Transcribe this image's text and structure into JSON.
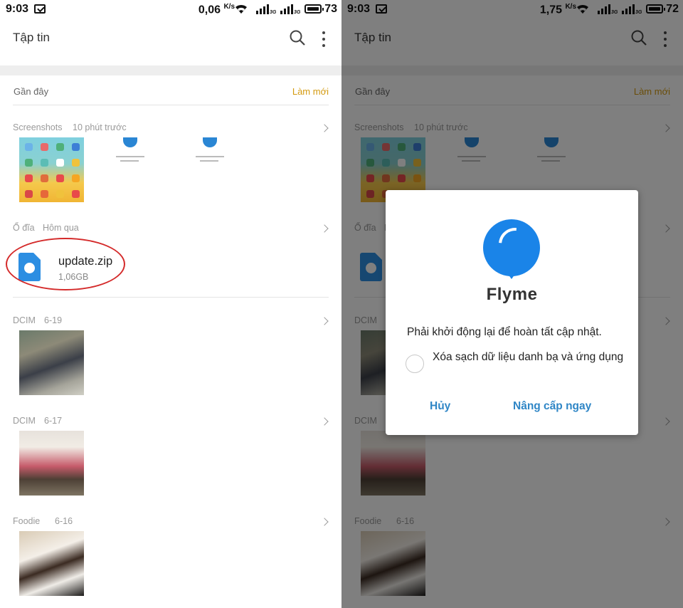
{
  "left": {
    "status": {
      "time": "9:03",
      "speed": "0,06",
      "speed_unit": "K/s",
      "net1": "3G",
      "net2": "3G",
      "battery": "73"
    }
  },
  "right": {
    "status": {
      "time": "9:03",
      "speed": "1,75",
      "speed_unit": "K/s",
      "net1": "3G",
      "net2": "3G",
      "battery": "72"
    }
  },
  "appbar": {
    "title": "Tập tin"
  },
  "recent": {
    "label": "Gần đây",
    "refresh": "Làm mới"
  },
  "sections": [
    {
      "source": "Screenshots",
      "when": "10 phút trước"
    },
    {
      "source": "Ổ đĩa",
      "when": "Hôm qua"
    },
    {
      "source": "DCIM",
      "when": "6-19"
    },
    {
      "source": "DCIM",
      "when": "6-17"
    },
    {
      "source": "Foodie",
      "when": "6-16"
    }
  ],
  "file": {
    "name": "update.zip",
    "size": "1,06GB"
  },
  "dialog": {
    "brand": "Flyme",
    "message": "Phải khởi động lại để hoàn tất cập nhật.",
    "checkbox_label": "Xóa sạch dữ liệu danh bạ và ứng dụng",
    "cancel": "Hủy",
    "confirm": "Nâng cấp ngay"
  },
  "colors": {
    "accent_orange": "#d49a10",
    "dialog_button": "#2f86c6",
    "flyme_blue": "#1a84e8",
    "annotation_red": "#d42a2a"
  }
}
